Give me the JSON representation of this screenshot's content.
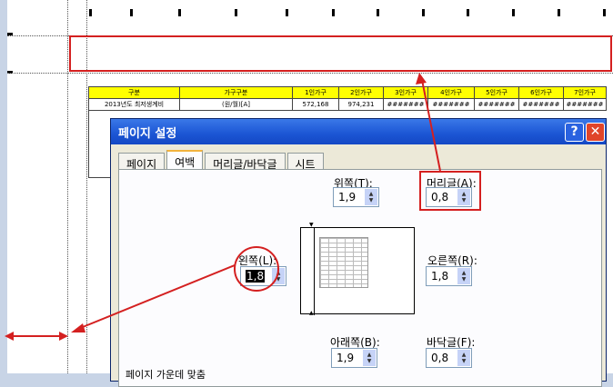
{
  "dialog": {
    "title": "페이지 설정",
    "help_glyph": "?",
    "close_glyph": "✕",
    "tabs": [
      {
        "label": "페이지",
        "active": false
      },
      {
        "label": "여백",
        "active": true
      },
      {
        "label": "머리글/바닥글",
        "active": false
      },
      {
        "label": "시트",
        "active": false
      }
    ],
    "top": {
      "label": "위쪽(T):",
      "value": "1,9"
    },
    "header": {
      "label": "머리글(A):",
      "value": "0,8"
    },
    "left": {
      "label": "왼쪽(L):",
      "value": "1,8"
    },
    "right": {
      "label": "오른쪽(R):",
      "value": "1,8"
    },
    "bottom": {
      "label": "아래쪽(B):",
      "value": "1,9"
    },
    "footer": {
      "label": "바닥글(F):",
      "value": "0,8"
    },
    "center_on_page": "페이지 가운데 맞춤"
  },
  "sheet": {
    "headers": [
      "구분",
      "가구구분",
      "1인가구",
      "2인가구",
      "3인가구",
      "4인가구",
      "5인가구",
      "6인가구",
      "7인가구"
    ],
    "rows": [
      [
        "2013년도 최저생계비",
        "(원/월)[A]",
        "572,168",
        "974,231",
        "#######",
        "#######",
        "#######",
        "#######",
        "#######"
      ]
    ]
  },
  "colors": {
    "callout": "#d42020",
    "titlebar": "#1b55d4",
    "sheet_header": "#ffff00"
  }
}
